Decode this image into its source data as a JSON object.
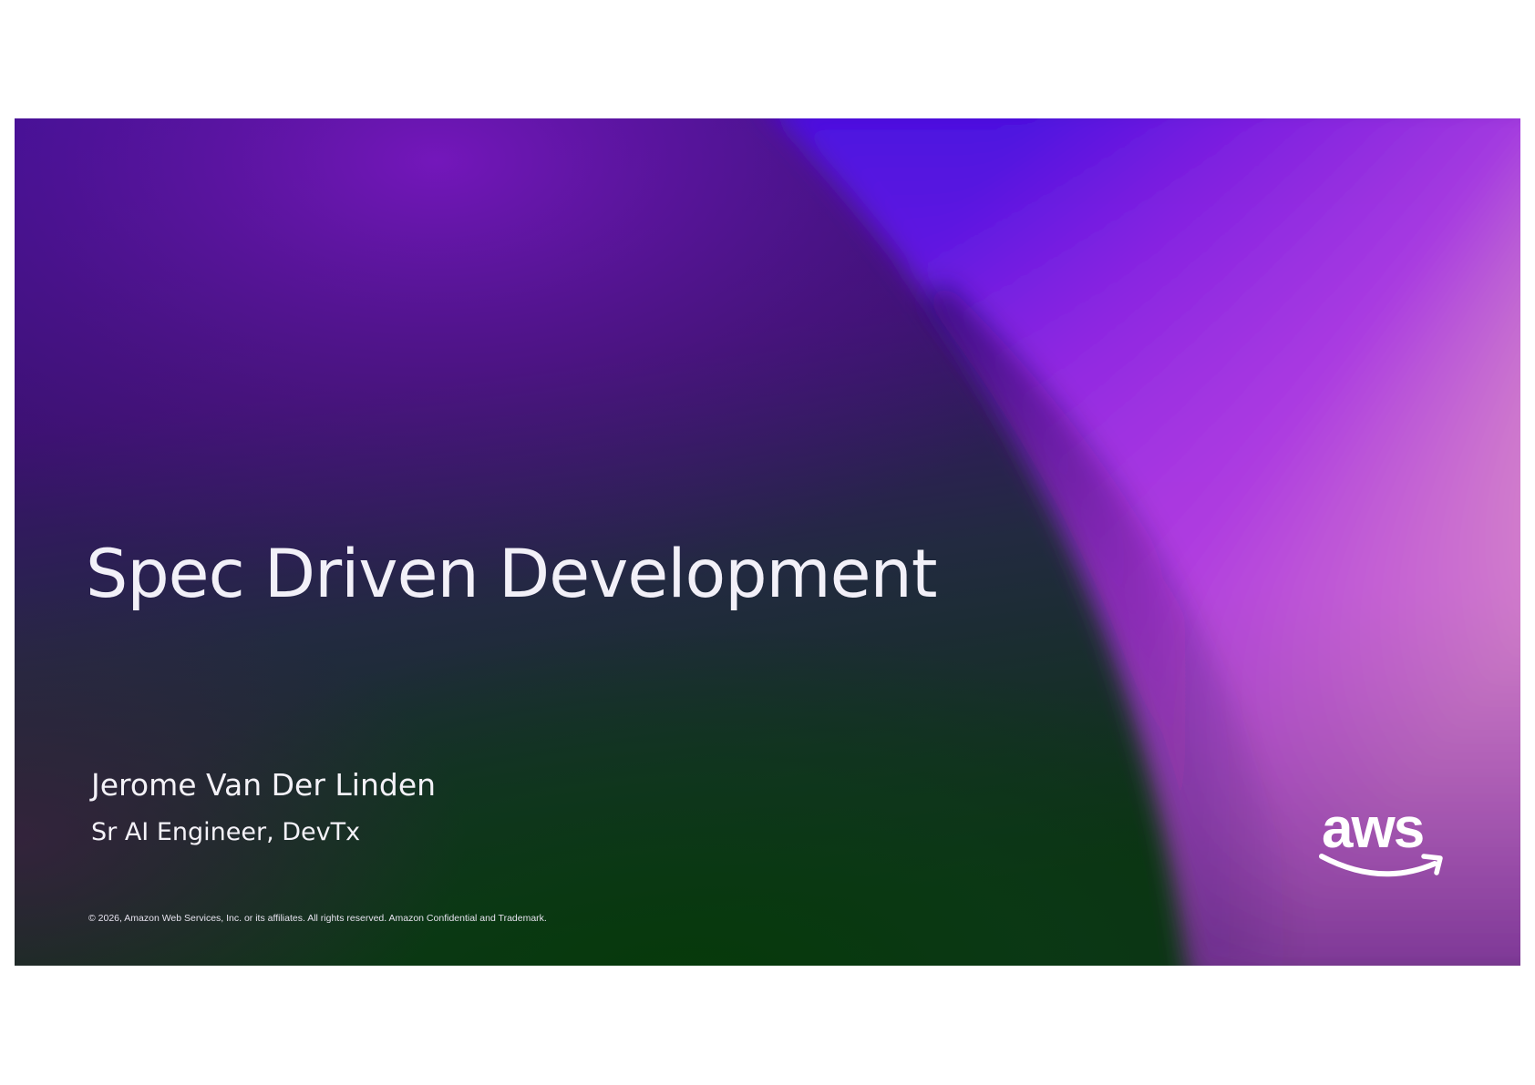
{
  "slide": {
    "title": "Spec Driven Development",
    "presenter_name": "Jerome Van Der Linden",
    "presenter_role": "Sr AI Engineer, DevTx",
    "copyright": "© 2026, Amazon Web Services, Inc. or its affiliates. All rights reserved. Amazon Confidential and Trademark.",
    "logo": {
      "text": "aws",
      "icon": "aws-smile-arrow-icon"
    }
  },
  "colors": {
    "page_background": "#ffffff",
    "text": "#f2f0f8",
    "deep_purple": "#3a0c8c",
    "violet": "#6a1fd8",
    "magenta": "#c040e0",
    "dark_green": "#0a3a10",
    "cream": "#fbe6b0"
  }
}
